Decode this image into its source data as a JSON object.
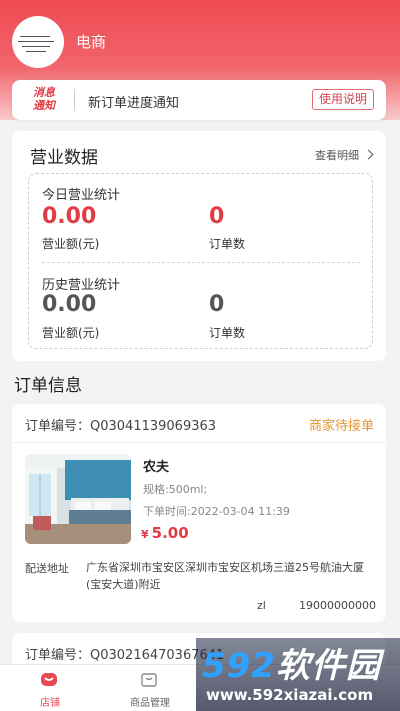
{
  "header": {
    "shop_name": "电商"
  },
  "notice": {
    "logo_line1": "消息",
    "logo_line2": "通知",
    "text": "新订单进度通知",
    "help_label": "使用说明"
  },
  "business": {
    "title": "营业数据",
    "detail_link": "查看明细",
    "today": {
      "heading": "今日营业统计",
      "revenue_value": "0.00",
      "revenue_label": "营业额(元)",
      "orders_value": "0",
      "orders_label": "订单数"
    },
    "history": {
      "heading": "历史营业统计",
      "revenue_value": "0.00",
      "revenue_label": "营业额(元)",
      "orders_value": "0",
      "orders_label": "订单数"
    }
  },
  "orders": {
    "title": "订单信息",
    "items": [
      {
        "order_no": "订单编号：Q03041139069363",
        "status": "商家待接单",
        "product_name": "农夫",
        "spec": "规格:500ml;",
        "time": "下单时间:2022-03-04 11:39",
        "currency": "¥",
        "price": "5.00",
        "address_label": "配送地址",
        "address": "广东省深圳市宝安区深圳市宝安区机场三道25号航油大厦(宝安大道)附近",
        "receiver": "zl",
        "phone": "19000000000"
      },
      {
        "order_no": "订单编号：Q030216470367641"
      }
    ]
  },
  "tabbar": {
    "tabs": [
      {
        "label": "店铺"
      },
      {
        "label": "商品管理"
      },
      {
        "label": ""
      },
      {
        "label": ""
      }
    ]
  },
  "watermark": {
    "brand_num": "592",
    "brand_text": "软件园",
    "url": "www.592xiazai.com"
  },
  "colors": {
    "brand_red": "#ee4a52",
    "value_red": "#e23b45",
    "status_orange": "#e8952e",
    "value_gray": "#555555"
  }
}
